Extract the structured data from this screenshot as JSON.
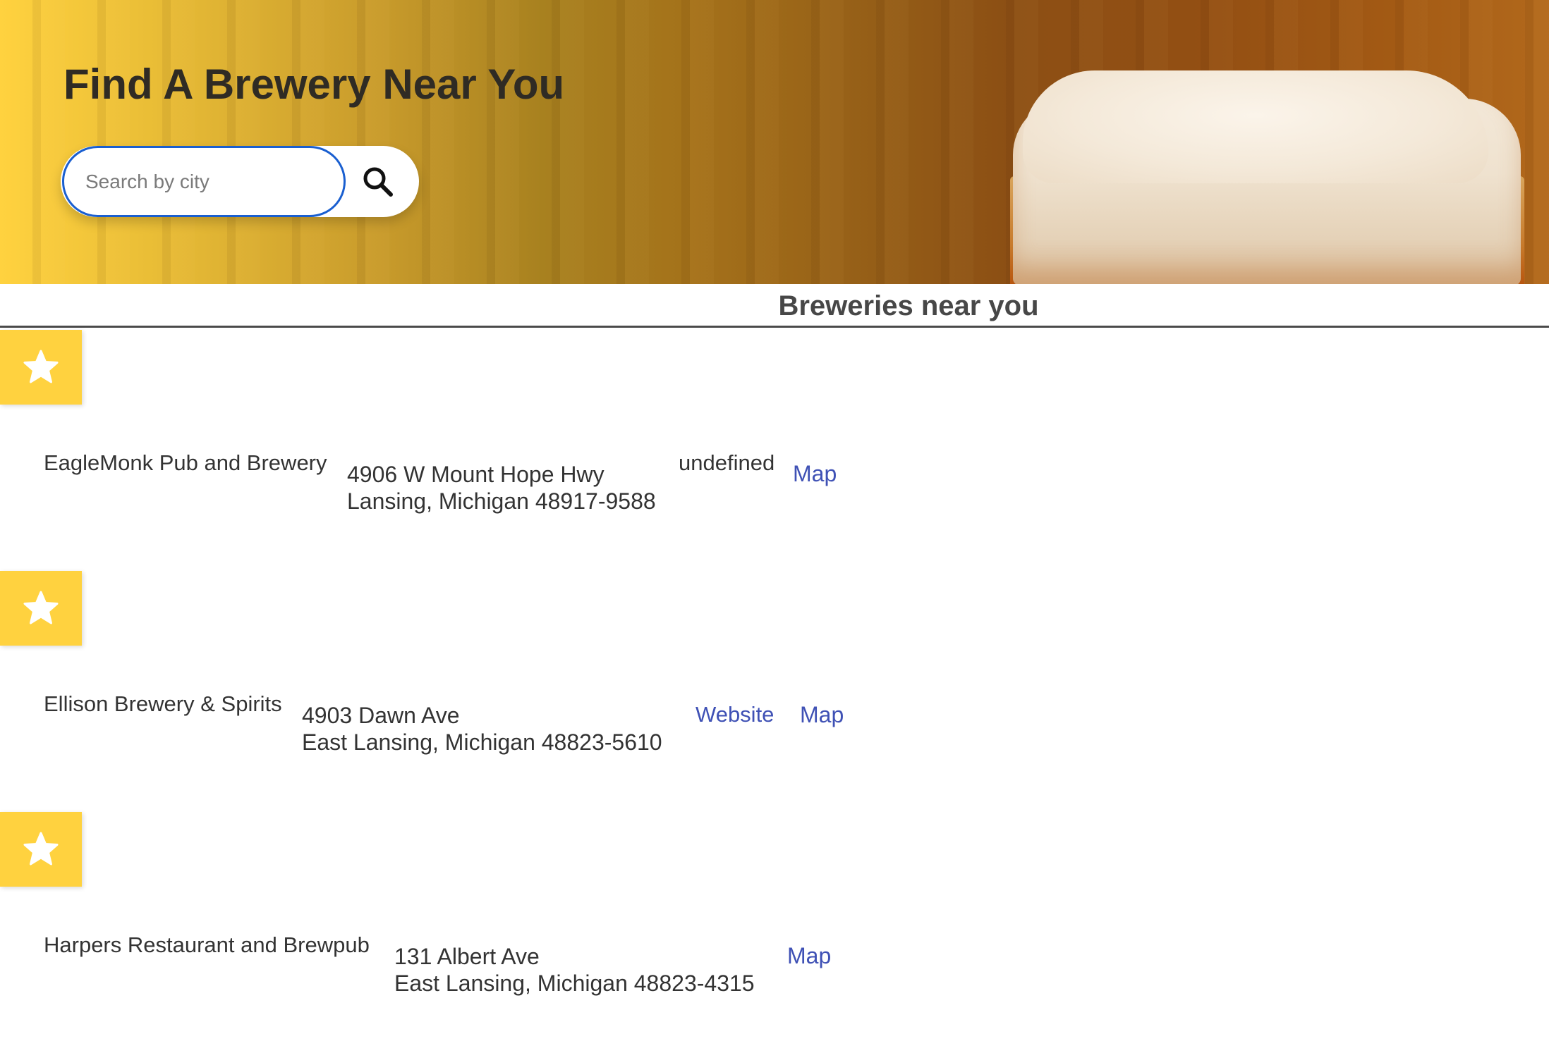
{
  "header": {
    "title": "Find A Brewery Near You",
    "search": {
      "placeholder": "Search by city",
      "button_icon": "search-icon"
    }
  },
  "results": {
    "title": "Breweries near you",
    "favorite_icon": "star-icon",
    "colors": {
      "accent": "#ffd23f",
      "link": "#3f51b5",
      "focus": "#1a5fd0"
    },
    "breweries": [
      {
        "name": "EagleMonk Pub and Brewery",
        "street": "4906 W Mount Hope Hwy",
        "city_line": "Lansing, Michigan 48917-9588",
        "website": "undefined",
        "map": "Map"
      },
      {
        "name": "Ellison Brewery & Spirits",
        "street": "4903 Dawn Ave",
        "city_line": "East Lansing, Michigan 48823-5610",
        "website": "Website",
        "map": "Map"
      },
      {
        "name": "Harpers Restaurant and Brewpub",
        "street": "131 Albert Ave",
        "city_line": "East Lansing, Michigan 48823-4315",
        "website": "",
        "map": "Map"
      }
    ]
  }
}
